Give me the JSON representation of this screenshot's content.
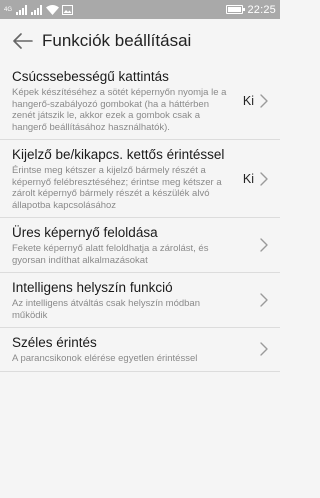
{
  "status_bar": {
    "network_label": "4G",
    "time": "22:25",
    "battery_level": 0.95
  },
  "header": {
    "title": "Funkciók beállításai",
    "back_icon": "arrow-left-icon"
  },
  "settings": [
    {
      "name": "quick-snapshot",
      "title": "Csúcssebességű kattintás",
      "description": "Képek készítéséhez a sötét képernyőn nyomja le a hangerő-szabályozó gombokat (ha a háttérben zenét játszik le, akkor ezek a gombok csak a hangerő beállításához használhatók).",
      "value": "Ki"
    },
    {
      "name": "double-tap-screen",
      "title": "Kijelző be/kikapcs. kettős érintéssel",
      "description": "Érintse meg kétszer a kijelző bármely részét a képernyő felébresztéséhez; érintse meg kétszer a zárolt képernyő bármely részét a készülék alvó állapotba kapcsolásához",
      "value": "Ki"
    },
    {
      "name": "blank-screen-unlock",
      "title": "Üres képernyő feloldása",
      "description": "Fekete képernyő alatt feloldhatja a zárolást, és gyorsan indíthat alkalmazásokat",
      "value": ""
    },
    {
      "name": "smart-location",
      "title": "Intelligens helyszín funkció",
      "description": "Az intelligens átváltás csak helyszín módban működik",
      "value": ""
    },
    {
      "name": "wide-touch",
      "title": "Széles érintés",
      "description": "A parancsikonok elérése egyetlen érintéssel",
      "value": ""
    }
  ]
}
